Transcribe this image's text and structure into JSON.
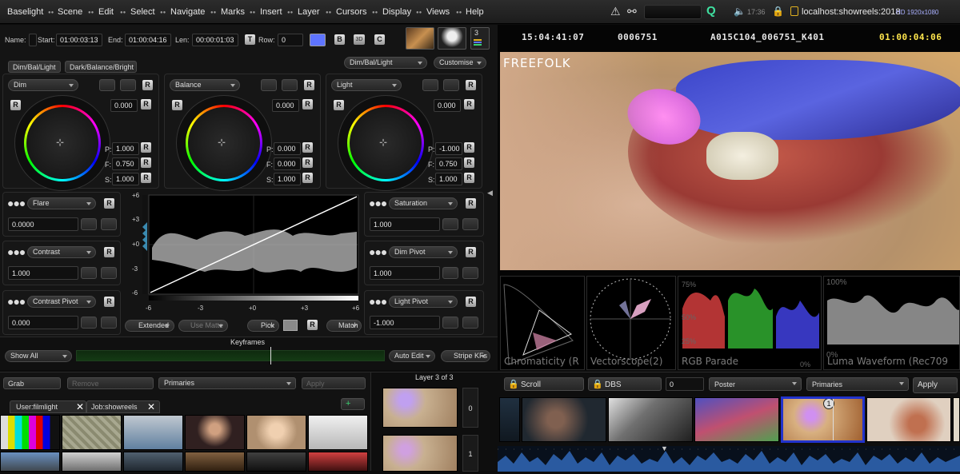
{
  "menubar": {
    "items": [
      "Baselight",
      "Scene",
      "Edit",
      "Select",
      "Navigate",
      "Marks",
      "Insert",
      "Layer",
      "Cursors",
      "Display",
      "Views",
      "Help"
    ],
    "time": "17:36",
    "host": "localhost:showreels:2018",
    "format": "HD 1920x1080"
  },
  "shot": {
    "name_label": "Name:",
    "start_label": "Start:",
    "start": "01:00:03:13",
    "end_label": "End:",
    "end": "01:00:04:16",
    "len_label": "Len:",
    "len": "00:00:01:03",
    "t_label": "T",
    "row_label": "Row:",
    "row": "0",
    "b_label": "B",
    "c_label": "C",
    "layer_count": "3"
  },
  "grade": {
    "tab1": "Dim/Bal/Light",
    "tab2": "Dark/Balance/Bright",
    "preset": "Dim/Bal/Light",
    "customise": "Customise",
    "wheels": [
      {
        "name": "Dim",
        "value": "0.000",
        "p": "1.000",
        "f": "0.750",
        "s": "1.000"
      },
      {
        "name": "Balance",
        "value": "0.000",
        "p": "0.000",
        "f": "0.000",
        "s": "1.000"
      },
      {
        "name": "Light",
        "value": "0.000",
        "p": "-1.000",
        "f": "0.750",
        "s": "1.000"
      }
    ],
    "p_label": "P:",
    "f_label": "F:",
    "s_label": "S:",
    "r_label": "R",
    "left_params": [
      {
        "name": "Flare",
        "value": "0.0000"
      },
      {
        "name": "Contrast",
        "value": "1.000"
      },
      {
        "name": "Contrast Pivot",
        "value": "0.000"
      }
    ],
    "right_params": [
      {
        "name": "Saturation",
        "value": "1.000"
      },
      {
        "name": "Dim Pivot",
        "value": "1.000"
      },
      {
        "name": "Light Pivot",
        "value": "-1.000"
      }
    ],
    "curve_y_ticks": [
      "+6",
      "+3",
      "+0",
      "-3",
      "-6"
    ],
    "curve_x_ticks": [
      "-6",
      "-3",
      "+0",
      "+3",
      "+6"
    ],
    "extended": "Extended",
    "use_matte": "Use Matte",
    "pick": "Pick",
    "match": "Match",
    "keyframes": "Keyframes",
    "show_all": "Show All",
    "auto_edit": "Auto Edit",
    "stripe_kfs": "Stripe KFs"
  },
  "browser": {
    "grab": "Grab",
    "remove": "Remove",
    "category": "Primaries",
    "apply": "Apply",
    "tab_user": "User:filmlight",
    "tab_job": "Job:showreels",
    "layer_title": "Layer 3 of 3",
    "layer_numbers": [
      "0",
      "1"
    ]
  },
  "viewer": {
    "timecode": "15:04:41:07",
    "frame": "0006751",
    "clip": "A015C104_006751_K401",
    "record_tc": "01:00:04:06",
    "watermark": "FREEFOLK"
  },
  "scopes": {
    "chromaticity": "Chromaticity (R",
    "vectorscope": "Vectorscope(2)",
    "rgb_parade": "RGB Parade",
    "luma": "Luma Waveform (Rec709",
    "pct_top": "100%",
    "pct_75": "75%",
    "pct_50": "50%",
    "pct_25": "25%",
    "pct_0": "0%"
  },
  "timeline": {
    "scroll": "Scroll",
    "dbs": "DBS",
    "value": "0",
    "mode": "Poster",
    "category": "Primaries",
    "apply": "Apply",
    "selected_badge": "1"
  },
  "colors": {
    "accent_blue": "#5e74ff",
    "timecode_yellow": "#ffe64d",
    "selection_blue": "#2233cc"
  }
}
